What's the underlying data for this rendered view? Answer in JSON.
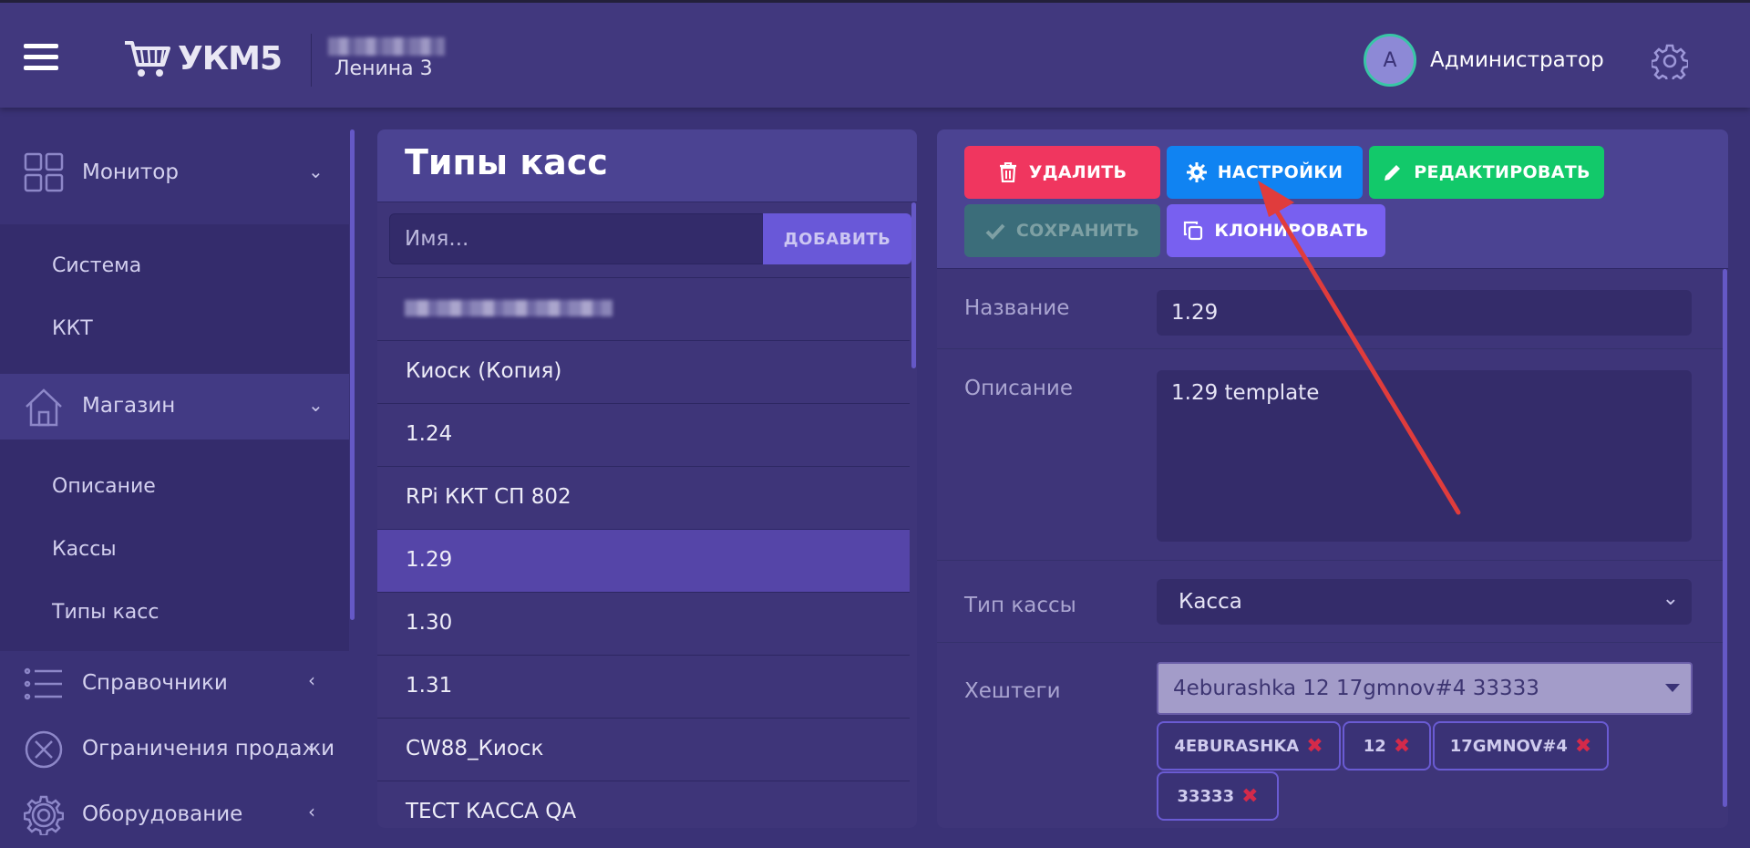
{
  "header": {
    "app_name": "УКМ5",
    "store_name": "Ленина 3",
    "user_initial": "A",
    "user_name": "Администратор"
  },
  "sidebar": {
    "sections": [
      {
        "label": "Монитор",
        "icon": "grid-icon",
        "items": [
          "Система",
          "ККТ"
        ]
      },
      {
        "label": "Магазин",
        "icon": "house-icon",
        "items": [
          "Описание",
          "Кассы",
          "Типы касс"
        ]
      },
      {
        "label": "Справочники",
        "icon": "list-icon",
        "items": []
      },
      {
        "label": "Ограничения продажи",
        "icon": "forbidden-icon",
        "items": []
      },
      {
        "label": "Оборудование",
        "icon": "gear-icon",
        "items": []
      }
    ]
  },
  "list_panel": {
    "title": "Типы касс",
    "search_placeholder": "Имя...",
    "add_label": "ДОБАВИТЬ",
    "items": [
      "Киоск (Копия)",
      "1.24",
      "RPi ККТ СП 802",
      "1.29",
      "1.30",
      "1.31",
      "CW88_Киоск",
      "ТЕСТ КАССА QA"
    ],
    "active_item": "1.29"
  },
  "detail_panel": {
    "buttons": {
      "delete": "УДАЛИТЬ",
      "settings": "НАСТРОЙКИ",
      "edit": "РЕДАКТИРОВАТЬ",
      "save": "СОХРАНИТЬ",
      "clone": "КЛОНИРОВАТЬ"
    },
    "fields": {
      "name_label": "Название",
      "name_value": "1.29",
      "desc_label": "Описание",
      "desc_value": "1.29 template",
      "type_label": "Тип кассы",
      "type_value": "Касса",
      "tags_label": "Хештеги",
      "tags_value": "4eburashka 12 17gmnov#4 33333"
    },
    "tags": [
      "4EBURASHKA",
      "12",
      "17GMNOV#4",
      "33333"
    ]
  },
  "colors": {
    "background": "#3a3276",
    "delete": "#f0365f",
    "settings": "#1083f2",
    "edit": "#12c96a",
    "clone": "#7860f0",
    "annotation_arrow": "#e03c3c"
  }
}
